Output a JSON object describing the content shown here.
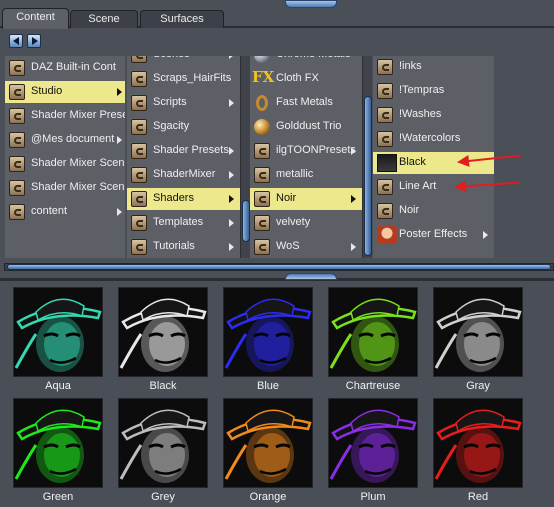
{
  "tabs": [
    {
      "label": "Content",
      "active": true
    },
    {
      "label": "Scene",
      "active": false
    },
    {
      "label": "Surfaces",
      "active": false
    }
  ],
  "columns": {
    "col1": {
      "items": [
        {
          "label": "DAZ Built-in Cont",
          "icon": "folder-icon",
          "selected": false,
          "has_arrow": false
        },
        {
          "label": "Studio",
          "icon": "folder-icon",
          "selected": true,
          "has_arrow": true
        },
        {
          "label": "Shader Mixer Prese",
          "icon": "folder-icon",
          "selected": false,
          "has_arrow": false
        },
        {
          "label": "@Mes document",
          "icon": "folder-icon",
          "selected": false,
          "has_arrow": true
        },
        {
          "label": "Shader Mixer Scene",
          "icon": "folder-icon",
          "selected": false,
          "has_arrow": false
        },
        {
          "label": "Shader Mixer Scene",
          "icon": "folder-icon",
          "selected": false,
          "has_arrow": false
        },
        {
          "label": "content",
          "icon": "folder-icon",
          "selected": false,
          "has_arrow": true
        }
      ]
    },
    "col2": {
      "items": [
        {
          "label": "Scenes",
          "icon": "folder-icon",
          "selected": false,
          "has_arrow": true
        },
        {
          "label": "Scraps_HairFits",
          "icon": "folder-icon",
          "selected": false,
          "has_arrow": false
        },
        {
          "label": "Scripts",
          "icon": "folder-icon",
          "selected": false,
          "has_arrow": true
        },
        {
          "label": "Sgacity",
          "icon": "folder-icon",
          "selected": false,
          "has_arrow": false
        },
        {
          "label": "Shader Presets",
          "icon": "folder-icon",
          "selected": false,
          "has_arrow": true
        },
        {
          "label": "ShaderMixer",
          "icon": "folder-icon",
          "selected": false,
          "has_arrow": true
        },
        {
          "label": "Shaders",
          "icon": "folder-icon",
          "selected": true,
          "has_arrow": true
        },
        {
          "label": "Templates",
          "icon": "folder-icon",
          "selected": false,
          "has_arrow": true
        },
        {
          "label": "Tutorials",
          "icon": "folder-icon",
          "selected": false,
          "has_arrow": true
        }
      ]
    },
    "col3": {
      "items": [
        {
          "label": "Chrome Metals",
          "icon": "chrome-ball-icon",
          "selected": false,
          "has_arrow": false
        },
        {
          "label": "Cloth FX",
          "icon": "fx-icon",
          "selected": false,
          "has_arrow": false
        },
        {
          "label": "Fast Metals",
          "icon": "metal-ring-icon",
          "selected": false,
          "has_arrow": false
        },
        {
          "label": "Golddust Trio",
          "icon": "gold-ball-icon",
          "selected": false,
          "has_arrow": false
        },
        {
          "label": "ilgTOONPresets",
          "icon": "folder-icon",
          "selected": false,
          "has_arrow": true
        },
        {
          "label": "metallic",
          "icon": "folder-icon",
          "selected": false,
          "has_arrow": false
        },
        {
          "label": "Noir",
          "icon": "folder-icon",
          "selected": true,
          "has_arrow": true
        },
        {
          "label": "velvety",
          "icon": "folder-icon",
          "selected": false,
          "has_arrow": false
        },
        {
          "label": "WoS",
          "icon": "folder-icon",
          "selected": false,
          "has_arrow": true
        }
      ]
    },
    "col4": {
      "items": [
        {
          "label": "!inks",
          "icon": "folder-icon",
          "selected": false,
          "has_arrow": false
        },
        {
          "label": "!Tempras",
          "icon": "folder-icon",
          "selected": false,
          "has_arrow": false
        },
        {
          "label": "!Washes",
          "icon": "folder-icon",
          "selected": false,
          "has_arrow": false
        },
        {
          "label": "!Watercolors",
          "icon": "folder-icon",
          "selected": false,
          "has_arrow": false
        },
        {
          "label": "Black",
          "icon": "noir-figure-icon",
          "selected": true,
          "has_arrow": false
        },
        {
          "label": "Line Art",
          "icon": "folder-icon",
          "selected": false,
          "has_arrow": false
        },
        {
          "label": "Noir",
          "icon": "folder-icon",
          "selected": false,
          "has_arrow": false
        },
        {
          "label": "Poster Effects",
          "icon": "poster-figure-icon",
          "selected": false,
          "has_arrow": true
        }
      ]
    }
  },
  "thumbnails": [
    {
      "label": "Aqua",
      "color": "#35d8b0"
    },
    {
      "label": "Black",
      "color": "#e8e8e8"
    },
    {
      "label": "Blue",
      "color": "#2c2cf0"
    },
    {
      "label": "Chartreuse",
      "color": "#79e21c"
    },
    {
      "label": "Gray",
      "color": "#d0d0d0"
    },
    {
      "label": "Green",
      "color": "#1ee81e"
    },
    {
      "label": "Grey",
      "color": "#bdbdbd"
    },
    {
      "label": "Orange",
      "color": "#f08a1e"
    },
    {
      "label": "Plum",
      "color": "#8a2ee6"
    },
    {
      "label": "Red",
      "color": "#e61e1e"
    }
  ],
  "colors": {
    "selection": "#ece88b",
    "annotation_arrow": "#e11d1d",
    "scroll_accent": "#5a86c0"
  }
}
